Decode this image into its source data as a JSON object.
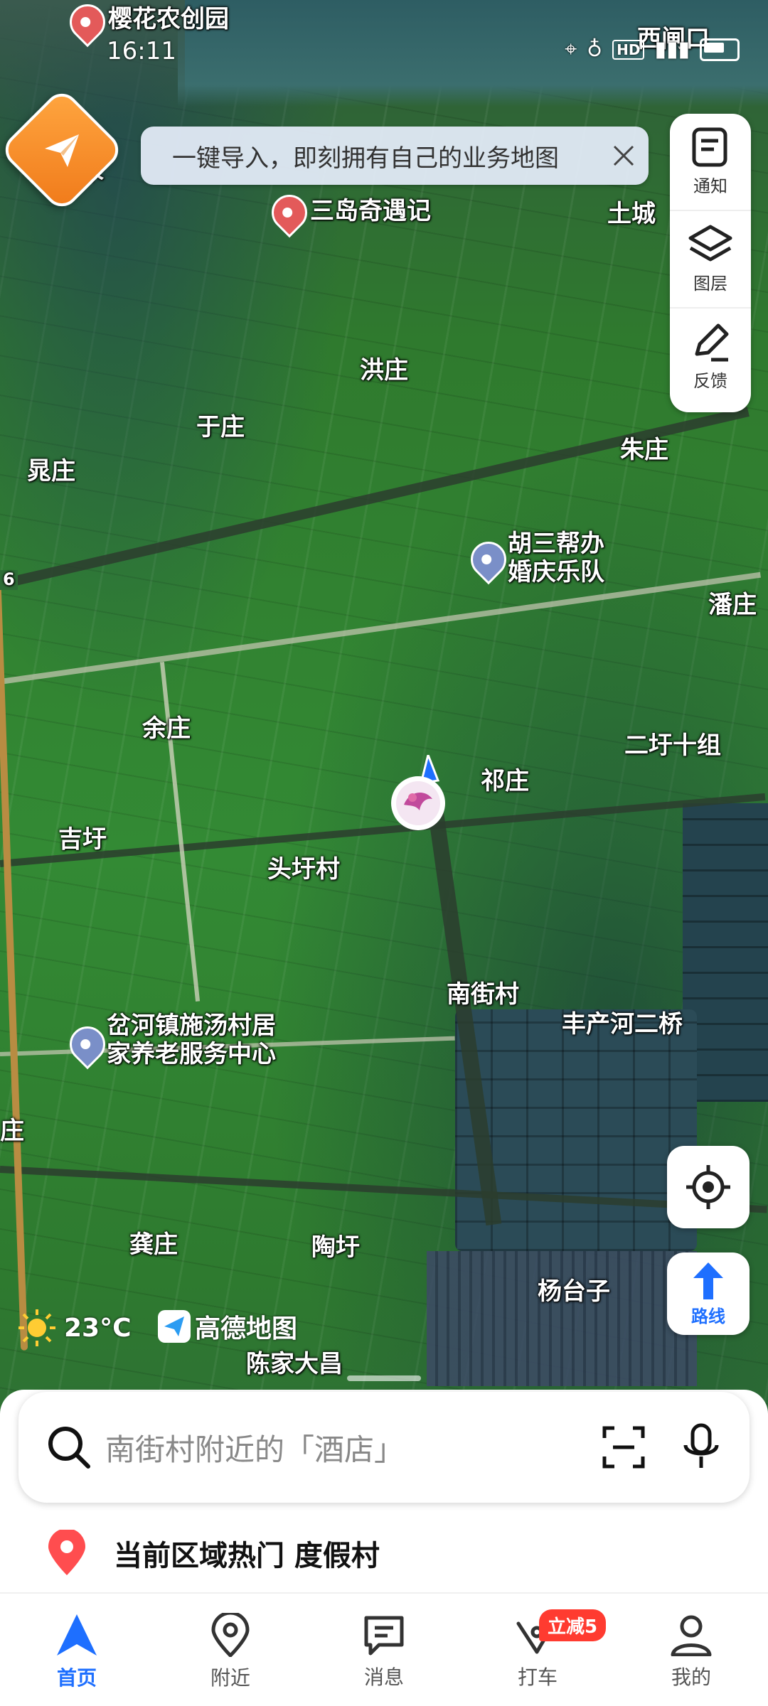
{
  "status_bar": {
    "time": "16:11",
    "hd": "HD"
  },
  "banner": {
    "text": "一键导入，即刻拥有自己的业务地图"
  },
  "side_panel": {
    "items": [
      {
        "label": "通知",
        "icon": "notice-icon"
      },
      {
        "label": "图层",
        "icon": "layers-icon"
      },
      {
        "label": "反馈",
        "icon": "feedback-icon"
      }
    ]
  },
  "map": {
    "labels": {
      "yinghua": "樱花农创园",
      "xizha": "西闸口",
      "zhu_top": "朱",
      "sandao": "三岛奇遇记",
      "tucheng": "土城",
      "hongzhuang": "洪庄",
      "yuzhuang": "于庄",
      "zhuzhuang": "朱庄",
      "huangzhuang": "晁庄",
      "husan_line1": "胡三帮办",
      "husan_line2": "婚庆乐队",
      "panzhuang": "潘庄",
      "erxu": "二圩十组",
      "yuzhuang2": "余庄",
      "qizhuang": "祁庄",
      "jixu": "吉圩",
      "touxu": "头圩村",
      "nanjie": "南街村",
      "fengchan": "丰产河二桥",
      "chahe_line1": "岔河镇施汤村居",
      "chahe_line2": "家养老服务中心",
      "zhuang_left": "庄",
      "gongzhuang": "龚庄",
      "taoxu": "陶圩",
      "yangtaizi": "杨台子",
      "chenjia": "陈家大昌",
      "road_num": "6"
    }
  },
  "route_button": {
    "label": "路线"
  },
  "weather": {
    "temperature": "23°C"
  },
  "brand": {
    "name": "高德地图"
  },
  "search": {
    "placeholder": "南街村附近的「酒店」"
  },
  "hot_row": {
    "text": "当前区域热门 度假村"
  },
  "tabbar": {
    "tabs": [
      {
        "label": "首页",
        "active": true
      },
      {
        "label": "附近",
        "active": false
      },
      {
        "label": "消息",
        "active": false
      },
      {
        "label": "打车",
        "active": false,
        "badge": "立减5"
      },
      {
        "label": "我的",
        "active": false
      }
    ]
  },
  "colors": {
    "accent": "#1e6fff",
    "brand_orange": "#f07a1a",
    "badge_red": "#ff3b30"
  }
}
